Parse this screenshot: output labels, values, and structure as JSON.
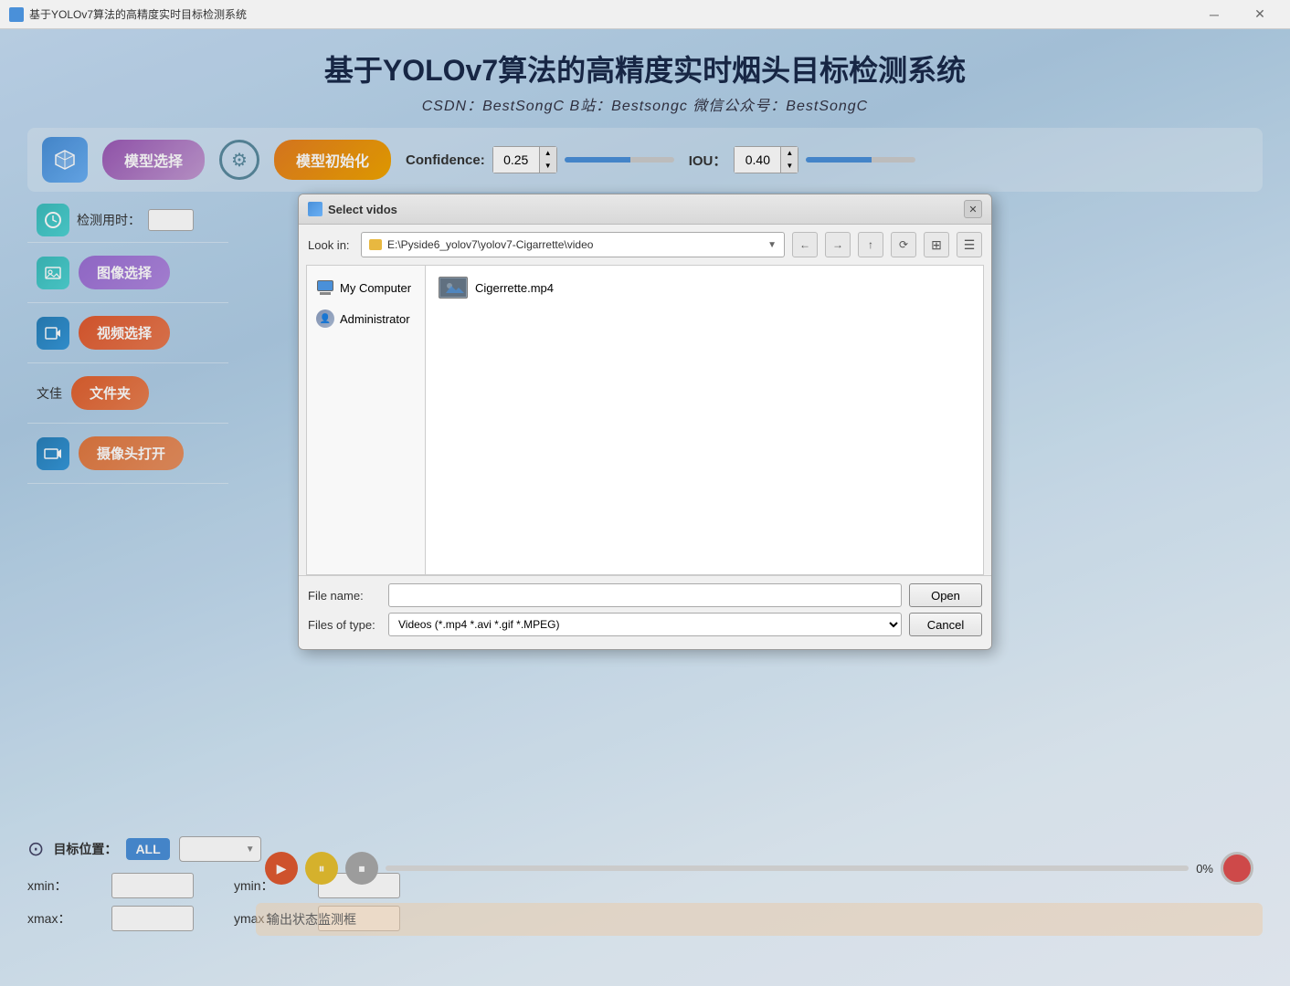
{
  "window": {
    "title": "基于YOLOv7算法的高精度实时目标检测系统",
    "minimize_label": "─",
    "close_label": "✕"
  },
  "header": {
    "title": "基于YOLOv7算法的高精度实时烟头目标检测系统",
    "subtitle": "CSDN：BestSongC  B站：Bestsongc  微信公众号：BestSongC"
  },
  "toolbar": {
    "model_select_label": "模型选择",
    "model_init_label": "模型初始化",
    "confidence_label": "Confidence:",
    "confidence_value": "0.25",
    "iou_label": "IOU：",
    "iou_value": "0.40"
  },
  "sidebar": {
    "detect_time_label": "检测用时：",
    "image_select_label": "图像选择",
    "video_select_label": "视频选择",
    "folder_label": "文件夹",
    "folder_text": "文佳",
    "camera_label": "摄像头打开"
  },
  "bottom_left": {
    "target_label": "目标位置：",
    "all_label": "ALL",
    "xmin_label": "xmin：",
    "ymin_label": "ymin：",
    "xmax_label": "xmax：",
    "ymax_label": "ymax："
  },
  "video_controls": {
    "progress_pct": "0%"
  },
  "status": {
    "placeholder": "输出状态监测框"
  },
  "dialog": {
    "title": "Select vidos",
    "look_in_label": "Look in:",
    "path": "E:\\Pyside6_yolov7\\yolov7-Cigarrette\\video",
    "sidebar_items": [
      {
        "label": "My Computer",
        "type": "computer"
      },
      {
        "label": "Administrator",
        "type": "admin"
      }
    ],
    "files": [
      {
        "name": "Cigerrette.mp4",
        "type": "video"
      }
    ],
    "file_name_label": "File name:",
    "file_name_value": "",
    "files_of_type_label": "Files of type:",
    "files_of_type_value": "Videos (*.mp4 *.avi *.gif *.MPEG)",
    "open_label": "Open",
    "cancel_label": "Cancel"
  }
}
